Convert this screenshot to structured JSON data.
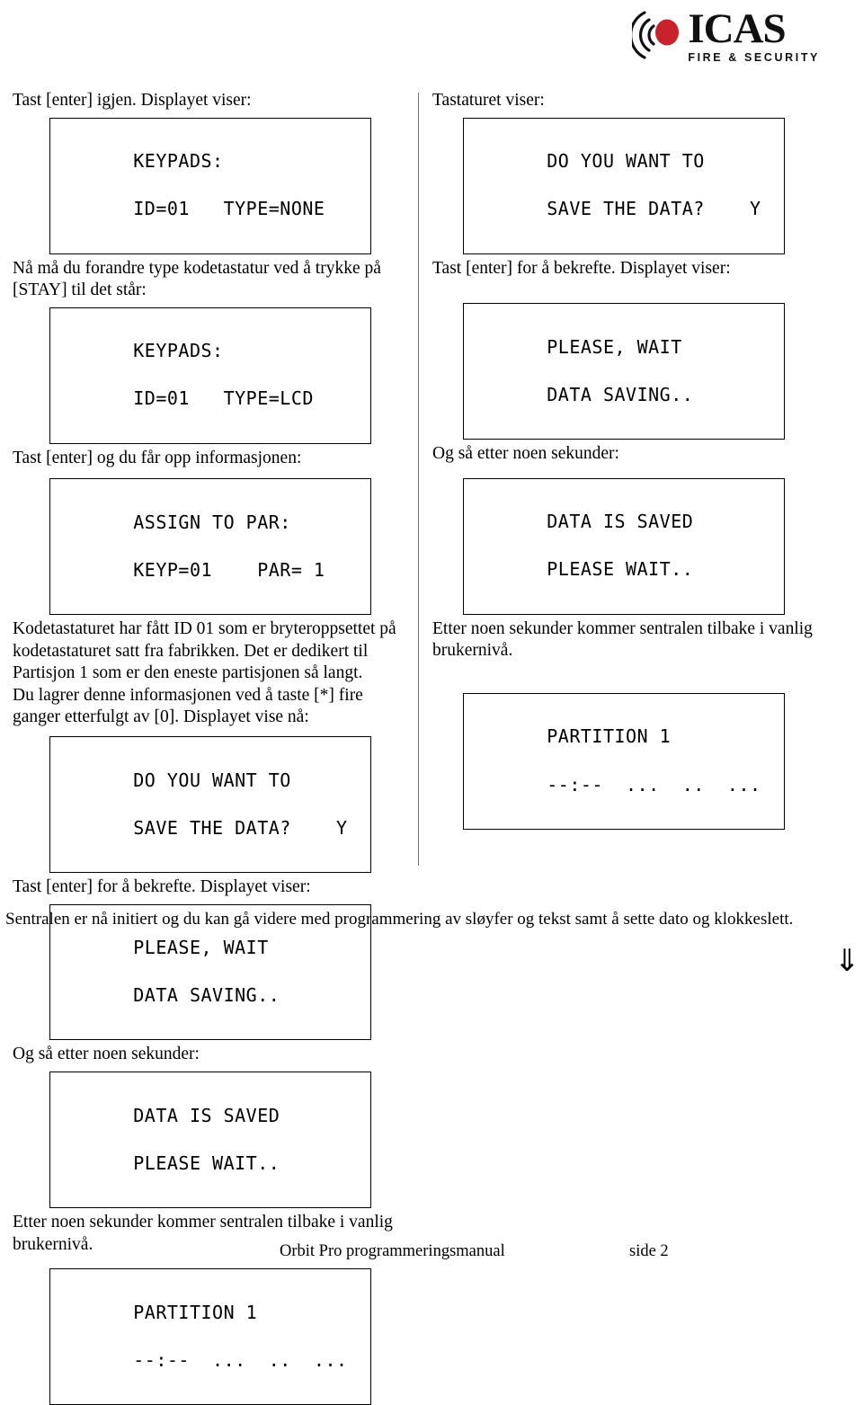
{
  "brand": {
    "name": "ICAS",
    "tagline": "FIRE & SECURITY",
    "mark_icon": "icas-signal-mark-icon",
    "accent_color": "#c8232c",
    "text_color": "#111111"
  },
  "left_column": {
    "blocks": [
      {
        "kind": "paragraph",
        "text": "Tast [enter] igjen. Displayet viser:"
      },
      {
        "kind": "lcd",
        "line1": "KEYPADS:",
        "line2": "ID=01   TYPE=NONE"
      },
      {
        "kind": "paragraph",
        "text": "Nå må du forandre type kodetastatur ved å trykke på [STAY] til det står:"
      },
      {
        "kind": "lcd",
        "line1": "KEYPADS:",
        "line2": "ID=01   TYPE=LCD"
      },
      {
        "kind": "paragraph",
        "text": "Tast [enter] og du får opp informasjonen:"
      },
      {
        "kind": "lcd",
        "line1": "ASSIGN TO PAR:",
        "line2": "KEYP=01    PAR= 1"
      },
      {
        "kind": "paragraph",
        "text": "Kodetastaturet har fått ID 01 som er bryteroppsettet på kodetastaturet satt fra fabrikken. Det er dedikert til Partisjon 1 som er den eneste partisjonen så langt."
      },
      {
        "kind": "paragraph",
        "text": "Du lagrer denne informasjonen ved å taste [*] fire ganger etterfulgt av [0]. Displayet vise nå:"
      },
      {
        "kind": "lcd",
        "line1": "DO YOU WANT TO",
        "line2": "SAVE THE DATA?    Y"
      },
      {
        "kind": "paragraph",
        "text": "Tast [enter] for å bekrefte. Displayet viser:"
      },
      {
        "kind": "lcd",
        "line1": "PLEASE, WAIT",
        "line2": "DATA SAVING.."
      },
      {
        "kind": "paragraph",
        "text": "Og så etter noen sekunder:"
      },
      {
        "kind": "lcd",
        "line1": "DATA IS SAVED",
        "line2": "PLEASE WAIT.."
      },
      {
        "kind": "paragraph",
        "text": "Etter noen sekunder kommer sentralen tilbake i vanlig brukernivå."
      },
      {
        "kind": "lcd",
        "line1": "PARTITION 1",
        "line2": "--:--  ...  ..  ..."
      }
    ]
  },
  "right_column": {
    "blocks": [
      {
        "kind": "paragraph",
        "text": "Tastaturet viser:"
      },
      {
        "kind": "lcd",
        "line1": "DO YOU WANT TO",
        "line2": "SAVE THE DATA?    Y"
      },
      {
        "kind": "paragraph",
        "text": "Tast [enter] for å bekrefte. Displayet viser:"
      },
      {
        "kind": "lcd",
        "line1": "PLEASE, WAIT",
        "line2": "DATA SAVING.."
      },
      {
        "kind": "paragraph",
        "text": "Og så etter noen sekunder:"
      },
      {
        "kind": "lcd",
        "line1": "DATA IS SAVED",
        "line2": "PLEASE WAIT.."
      },
      {
        "kind": "paragraph",
        "text": "Etter noen sekunder kommer sentralen tilbake i vanlig brukernivå."
      },
      {
        "kind": "lcd",
        "line1": "PARTITION 1",
        "line2": "--:--  ...  ..  ..."
      }
    ]
  },
  "closing": {
    "text": "Sentralen er nå initiert og du kan gå videre med programmering av sløyfer og tekst samt å sette dato og klokkeslett.",
    "continuation_arrow": "⇓"
  },
  "footer": {
    "title": "Orbit Pro programmeringsmanual",
    "page_label": "side 2"
  }
}
